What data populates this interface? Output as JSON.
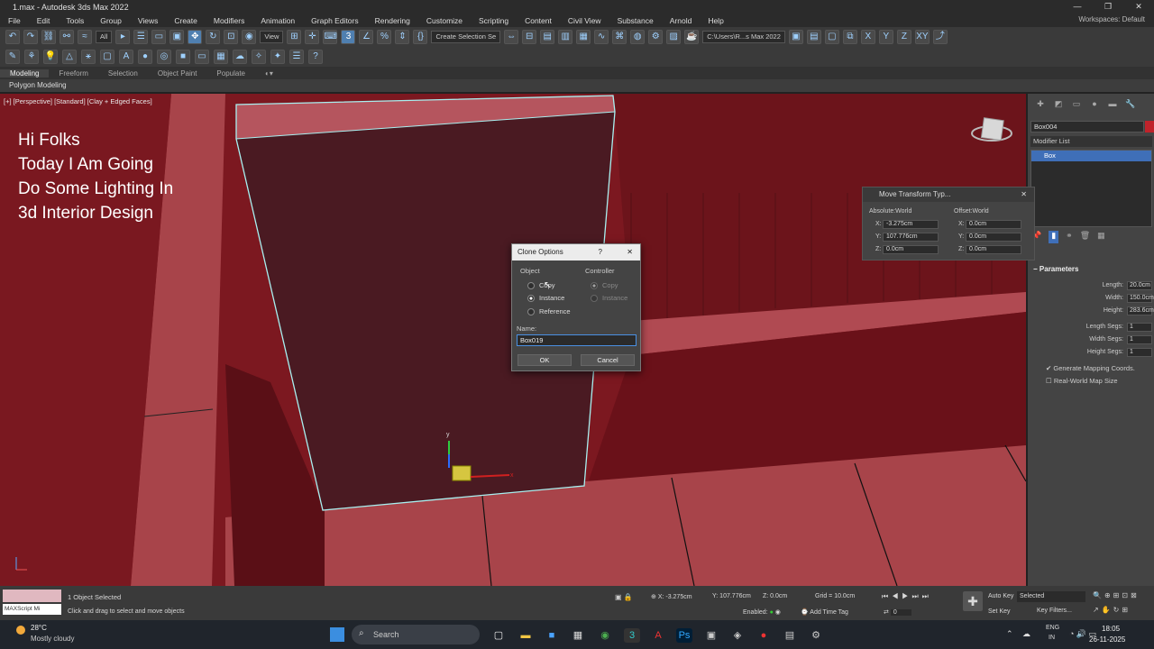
{
  "window": {
    "title": "1.max - Autodesk 3ds Max 2022",
    "controls": [
      "—",
      "❐",
      "✕"
    ]
  },
  "menu": {
    "items": [
      "File",
      "Edit",
      "Tools",
      "Group",
      "Views",
      "Create",
      "Modifiers",
      "Animation",
      "Graph Editors",
      "Rendering",
      "Customize",
      "Scripting",
      "Content",
      "Civil View",
      "Substance",
      "Arnold",
      "Help"
    ],
    "workspaces_label": "Workspaces:",
    "workspaces_value": "Default"
  },
  "toolbar": {
    "selection_filter": "All",
    "ref_coord": "View",
    "named_sel": "Create Selection Se",
    "project_path": "C:\\Users\\R...s Max 2022"
  },
  "ribbon": {
    "tabs": [
      "Modeling",
      "Freeform",
      "Selection",
      "Object Paint",
      "Populate"
    ],
    "active": "Modeling",
    "sub_label": "Polygon Modeling"
  },
  "viewport": {
    "label": "[+] [Perspective] [Standard] [Clay + Edged Faces]",
    "overlay_lines": [
      "Hi Folks",
      "Today I Am Going",
      "Do Some Lighting In",
      "3d Interior Design"
    ],
    "colors": {
      "wall": "#8c1c24",
      "panel": "#4a1a22",
      "floor": "#a8444a",
      "selection_edge": "#a8f0f0"
    }
  },
  "clone_dialog": {
    "title": "Clone Options",
    "help": "?",
    "close": "✕",
    "object_label": "Object",
    "controller_label": "Controller",
    "object_options": [
      "Copy",
      "Instance",
      "Reference"
    ],
    "object_selected": "Instance",
    "controller_options": [
      "Copy",
      "Instance"
    ],
    "name_label": "Name:",
    "name_value": "Box019",
    "ok": "OK",
    "cancel": "Cancel"
  },
  "move_dialog": {
    "title": "Move Transform Typ...",
    "absolute_label": "Absolute:World",
    "offset_label": "Offset:World",
    "abs_x": "-3.275cm",
    "abs_y": "107.776cm",
    "abs_z": "0.0cm",
    "off_x": "0.0cm",
    "off_y": "0.0cm",
    "off_z": "0.0cm"
  },
  "command_panel": {
    "object_name": "Box004",
    "modifier_list": "Modifier List",
    "stack_item": "Box",
    "params_title": "Parameters",
    "params": [
      {
        "label": "Length:",
        "value": "20.0cm"
      },
      {
        "label": "Width:",
        "value": "150.0cm"
      },
      {
        "label": "Height:",
        "value": "283.6cm"
      },
      {
        "label": "Length Segs:",
        "value": "1"
      },
      {
        "label": "Width Segs:",
        "value": "1"
      },
      {
        "label": "Height Segs:",
        "value": "1"
      }
    ],
    "gen_mapping": "Generate Mapping Coords.",
    "real_world": "Real-World Map Size"
  },
  "status": {
    "maxscript": "MAXScript Mi",
    "selected": "1 Object Selected",
    "hint": "Click and drag to select and move objects",
    "x": "X: -3.275cm",
    "y": "Y: 107.776cm",
    "z": "Z: 0.0cm",
    "grid": "Grid = 10.0cm",
    "enabled": "Enabled:",
    "add_time_tag": "Add Time Tag",
    "auto_key": "Auto Key",
    "set_key": "Set Key",
    "selected_dd": "Selected",
    "key_filters": "Key Filters...",
    "frame": "0"
  },
  "taskbar": {
    "temp": "28°C",
    "weather": "Mostly cloudy",
    "search": "Search",
    "lang1": "ENG",
    "lang2": "IN",
    "time": "18:05",
    "date": "26-11-2025"
  }
}
